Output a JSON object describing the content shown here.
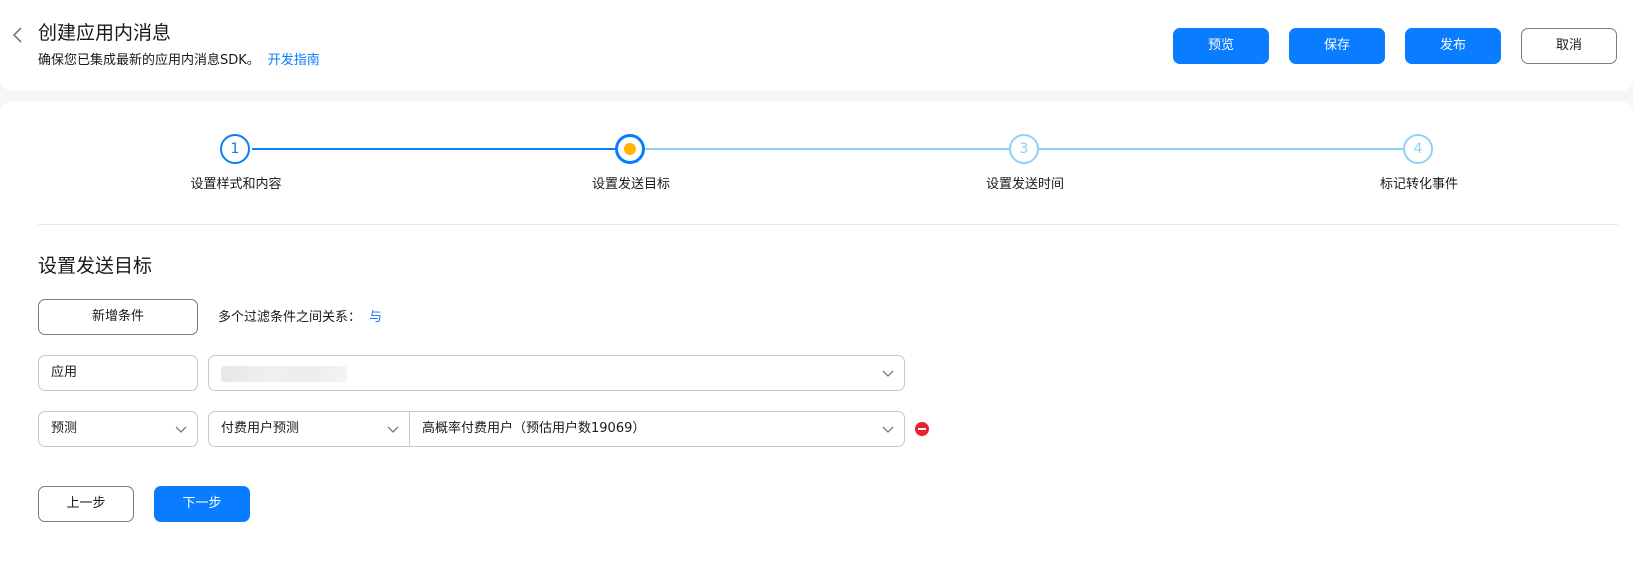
{
  "header": {
    "title": "创建应用内消息",
    "subtitle": "确保您已集成最新的应用内消息SDK。",
    "guide_link": "开发指南",
    "actions": {
      "preview": "预览",
      "save": "保存",
      "publish": "发布",
      "cancel": "取消"
    }
  },
  "stepper": {
    "steps": [
      {
        "number": "1",
        "label": "设置样式和内容",
        "state": "completed"
      },
      {
        "number": "",
        "label": "设置发送目标",
        "state": "current"
      },
      {
        "number": "3",
        "label": "设置发送时间",
        "state": "pending"
      },
      {
        "number": "4",
        "label": "标记转化事件",
        "state": "pending"
      }
    ]
  },
  "target": {
    "section_title": "设置发送目标",
    "add_condition": "新增条件",
    "relation_label": "多个过滤条件之间关系：",
    "relation_value": "与",
    "conditions": [
      {
        "label": "应用",
        "value": ""
      },
      {
        "type": "预测",
        "predict_model": "付费用户预测",
        "value": "高概率付费用户（预估用户数19069）"
      }
    ]
  },
  "footer": {
    "prev": "上一步",
    "next": "下一步"
  },
  "colors": {
    "primary": "#0a7cff",
    "pending": "#8fd2f8",
    "current_dot": "#ffb400",
    "danger": "#e8232e"
  },
  "icons": {
    "back": "chevron-left-icon",
    "dropdown": "chevron-down-icon",
    "remove": "minus-circle-icon"
  }
}
